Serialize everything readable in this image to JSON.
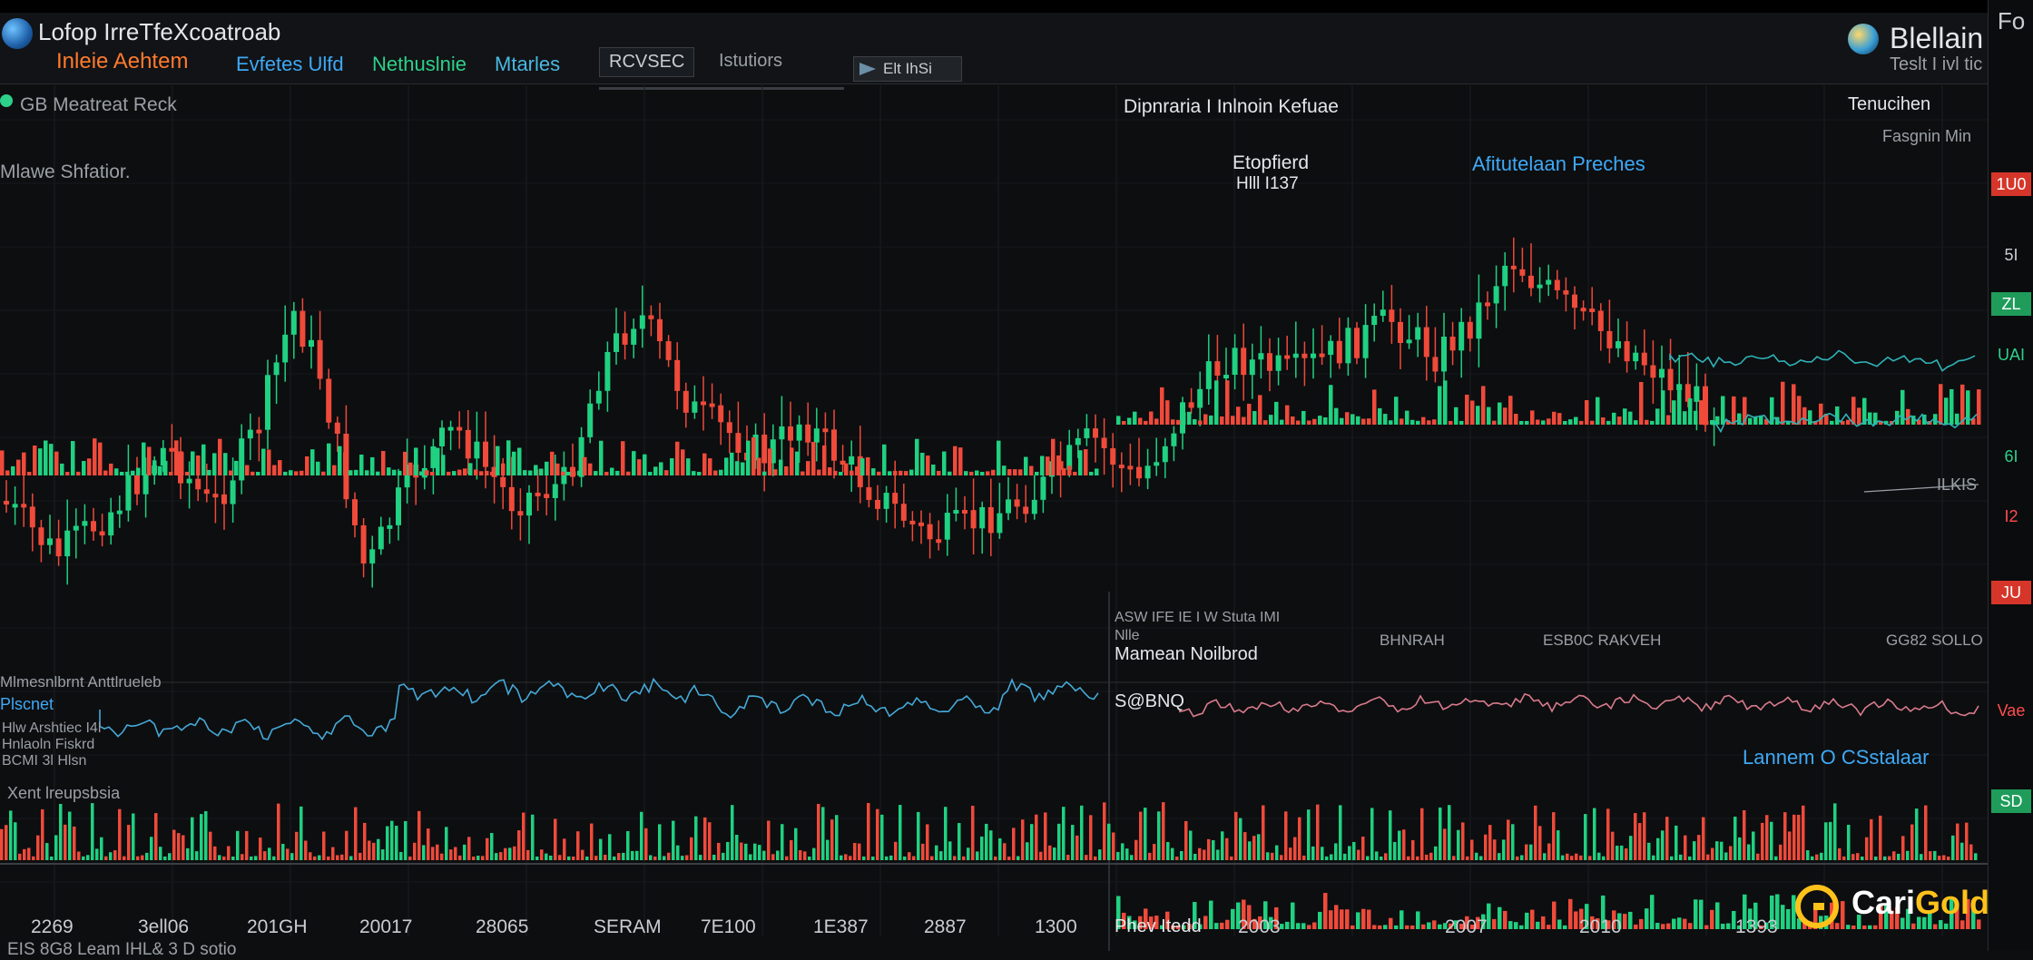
{
  "header": {
    "brand_line1": "Lofop IrreTfeXcoatroab",
    "brand_line2": "Inleie Aehtem",
    "nav": [
      "Evfetes Ulfd",
      "Nethuslnie",
      "Mtarles"
    ],
    "tabs": [
      "RCVSEC",
      "Istutiors"
    ],
    "price_box_label": "Elt IhSi",
    "right_title": "Blellain",
    "right_sub": "Teslt I ivl tic"
  },
  "panel": {
    "left_title": "GB Meatreat Reck",
    "center_title": "Dipnraria I Inlnoin Kefuae",
    "right_title": "Tenucihen",
    "right_sub": "Fasgnin Min",
    "left_sub": "Mlawe Shfatior.",
    "annotation1_l1": "Etopfierd",
    "annotation1_l2": "Hlll I137",
    "annotation2": "Afitutelaan Preches"
  },
  "lower": {
    "vol_label_left": "Mlmesnlbrnt Anttlrueleb",
    "vol_label_mid": "ASW IFE IE I W  Stuta IMI",
    "vol_label_mid2": "Nlle",
    "row1_a": "BHNRAH",
    "row1_b": "ESB0C RAKVEH",
    "row1_c": "GG82 SOLLO",
    "mid_panel_title": "Mamean Noilbrod",
    "osc_left_l1": "Plscnet",
    "osc_left_l2": "Hlw Arshtiec I4l",
    "osc_left_l3": "Hnlaoln Fiskrd",
    "osc_left_l4": "BCMI 3l Hlsn",
    "osc_mid_label": "S@BNQ",
    "osc_right_label": "Lannem O CSstalaar",
    "bottom_vol_label": "Xent lreupsbsia",
    "bottom_left_label": "EIS 8G8 Leam  IHL& 3 D sotio",
    "right_small_label": "ILKIS",
    "phy_label": "Phev Itedd"
  },
  "x_ticks": [
    "2269",
    "3ell06",
    "201GH",
    "20017",
    "28065",
    "SERAM",
    "7E100",
    "1E387",
    "2887",
    "1300",
    "2003",
    "2007",
    "2010",
    "1393"
  ],
  "rail": [
    "Fo",
    "1U0",
    "5I",
    "ZL",
    "UAI",
    "6I",
    "I2",
    "JU",
    "Vae",
    "SD"
  ],
  "watermark": {
    "part1": "Cari",
    "part2": "Gold"
  },
  "colors": {
    "up": "#1fd181",
    "down": "#ef4a3a",
    "osc_blue": "#45a9d8",
    "osc_pink": "#d87b8c",
    "osc_teal": "#2fb3b8",
    "gold": "#ffc21a"
  },
  "chart_data": {
    "type": "candlestick",
    "note_series": "main price candles with volume and oscillator panes",
    "candles_close": [
      368,
      372,
      360,
      345,
      340,
      352,
      366,
      371,
      378,
      376,
      362,
      355,
      360,
      372,
      384,
      395,
      402,
      410,
      418,
      430,
      438,
      448,
      452,
      460,
      470,
      482,
      495,
      502,
      508,
      512,
      520,
      526,
      534,
      538,
      545,
      552,
      558,
      560,
      566,
      572,
      580,
      588,
      596,
      604,
      612,
      618,
      624,
      628,
      634,
      640,
      638,
      630,
      624,
      618,
      612,
      606,
      600,
      594,
      588,
      582,
      576,
      570,
      564,
      558,
      552,
      546,
      540,
      534,
      528,
      522,
      518,
      514,
      510,
      506,
      504,
      500,
      498,
      496,
      494,
      490,
      486,
      482,
      478,
      474,
      470,
      466,
      462,
      458,
      454,
      450,
      448,
      446,
      444,
      442,
      440,
      438,
      436,
      434,
      432,
      430,
      428,
      426,
      424,
      422,
      420,
      418,
      416,
      414,
      412,
      410,
      408,
      406,
      404,
      402,
      400,
      398,
      396,
      394,
      392,
      390,
      388,
      386,
      384,
      382,
      380,
      378,
      376,
      374,
      372,
      370,
      368,
      366,
      364,
      362,
      360,
      358,
      356,
      354
    ],
    "volume_level": "mid",
    "oscillators": [
      "Plscnet",
      "S@BNQ"
    ]
  }
}
